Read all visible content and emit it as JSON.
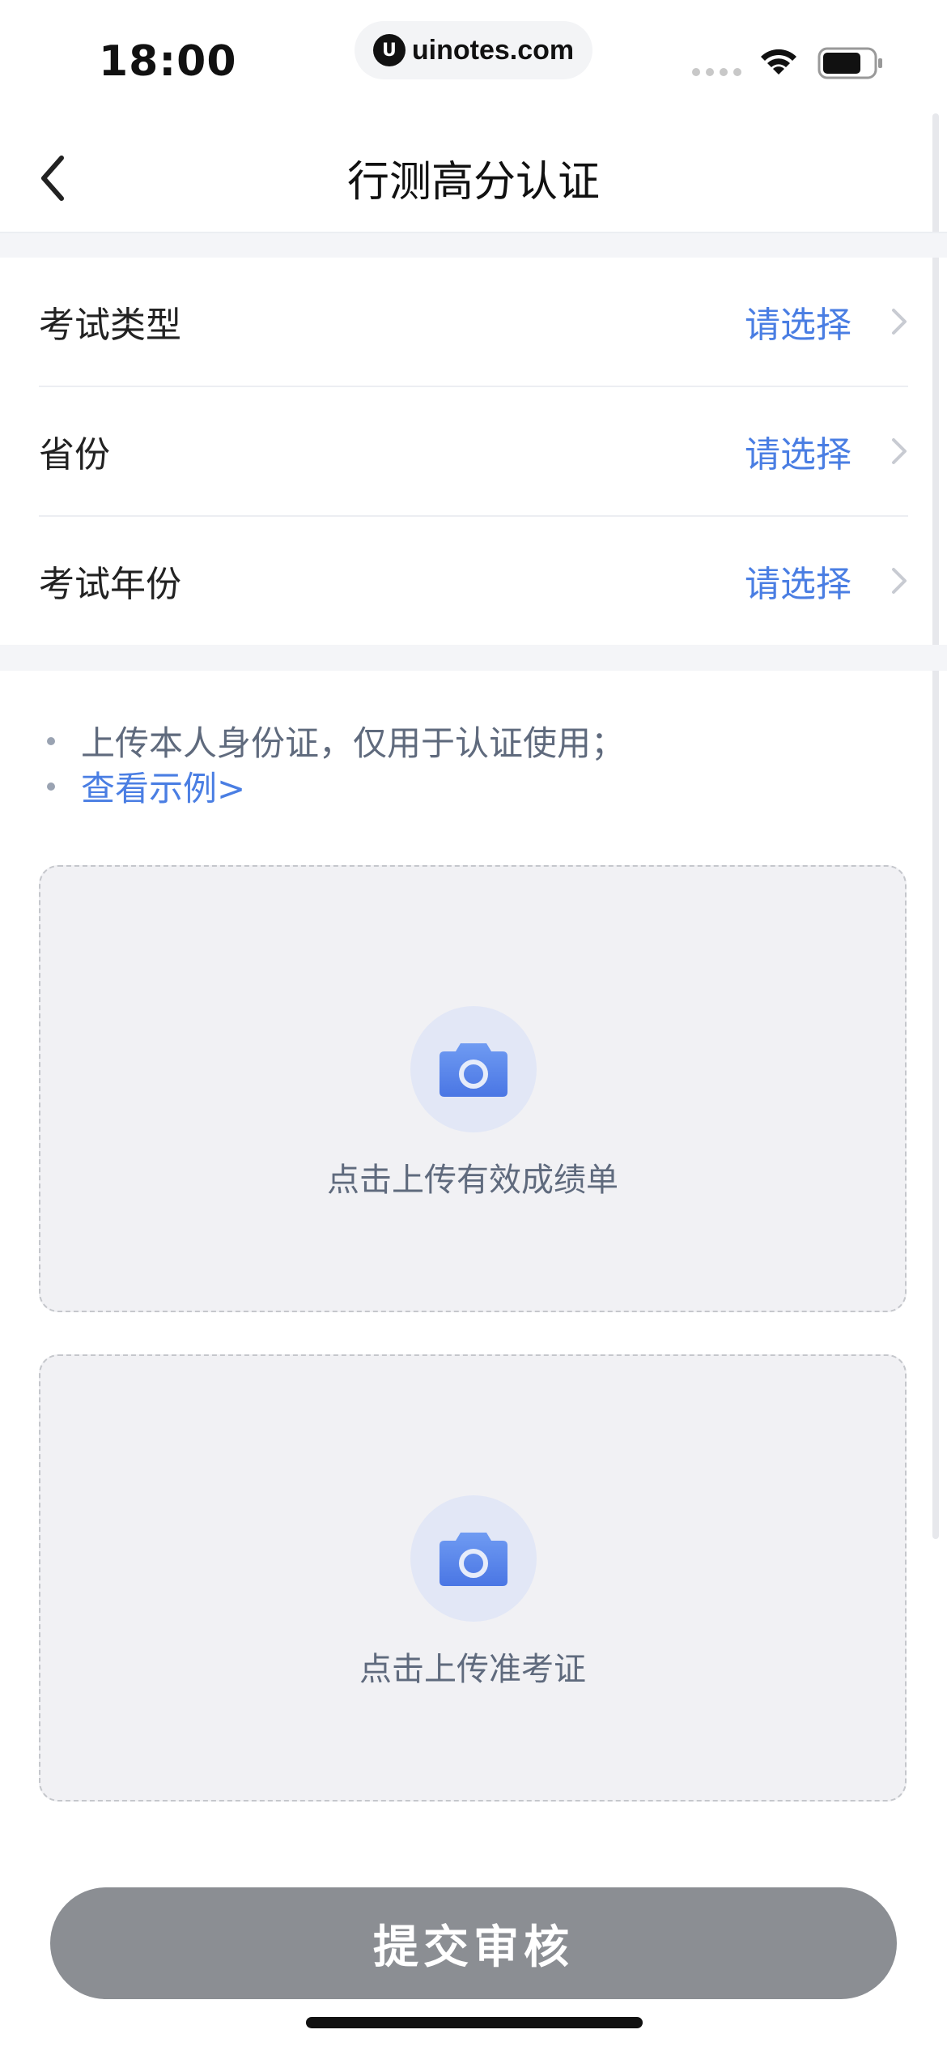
{
  "status_bar": {
    "time": "18:00",
    "url": "uinotes.com",
    "logo_glyph": "U"
  },
  "nav": {
    "title": "行测高分认证"
  },
  "form": {
    "rows": [
      {
        "label": "考试类型",
        "value": "请选择"
      },
      {
        "label": "省份",
        "value": "请选择"
      },
      {
        "label": "考试年份",
        "value": "请选择"
      }
    ]
  },
  "notes": {
    "line1": "上传本人身份证，仅用于认证使用；",
    "line2_link": "查看示例>"
  },
  "uploads": [
    {
      "label": "点击上传有效成绩单",
      "icon": "camera-icon"
    },
    {
      "label": "点击上传准考证",
      "icon": "camera-icon"
    }
  ],
  "submit": {
    "label": "提交审核"
  },
  "colors": {
    "accent": "#4a7ee3",
    "button_disabled": "#8b8e93",
    "upload_bg": "#f1f1f4"
  }
}
